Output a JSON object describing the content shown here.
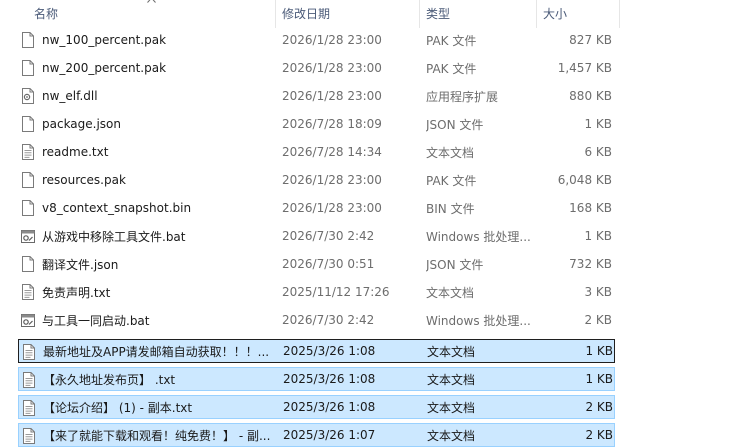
{
  "columns": {
    "name": "名称",
    "modified": "修改日期",
    "type": "类型",
    "size": "大小"
  },
  "files": [
    {
      "name": "nw_100_percent.pak",
      "modified": "2026/1/28 23:00",
      "type": "PAK 文件",
      "size": "827 KB",
      "icon": "file-icon",
      "selected": false
    },
    {
      "name": "nw_200_percent.pak",
      "modified": "2026/1/28 23:00",
      "type": "PAK 文件",
      "size": "1,457 KB",
      "icon": "file-icon",
      "selected": false
    },
    {
      "name": "nw_elf.dll",
      "modified": "2026/1/28 23:00",
      "type": "应用程序扩展",
      "size": "880 KB",
      "icon": "dll-icon",
      "selected": false
    },
    {
      "name": "package.json",
      "modified": "2026/7/28 18:09",
      "type": "JSON 文件",
      "size": "1 KB",
      "icon": "file-icon",
      "selected": false
    },
    {
      "name": "readme.txt",
      "modified": "2026/7/28 14:34",
      "type": "文本文档",
      "size": "6 KB",
      "icon": "text-file-icon",
      "selected": false
    },
    {
      "name": "resources.pak",
      "modified": "2026/1/28 23:00",
      "type": "PAK 文件",
      "size": "6,048 KB",
      "icon": "file-icon",
      "selected": false
    },
    {
      "name": "v8_context_snapshot.bin",
      "modified": "2026/1/28 23:00",
      "type": "BIN 文件",
      "size": "168 KB",
      "icon": "file-icon",
      "selected": false
    },
    {
      "name": "从游戏中移除工具文件.bat",
      "modified": "2026/7/30 2:42",
      "type": "Windows 批处理...",
      "size": "1 KB",
      "icon": "batch-file-icon",
      "selected": false
    },
    {
      "name": "翻译文件.json",
      "modified": "2026/7/30 0:51",
      "type": "JSON 文件",
      "size": "732 KB",
      "icon": "file-icon",
      "selected": false
    },
    {
      "name": "免责声明.txt",
      "modified": "2025/11/12 17:26",
      "type": "文本文档",
      "size": "3 KB",
      "icon": "text-file-icon",
      "selected": false
    },
    {
      "name": "与工具一同启动.bat",
      "modified": "2026/7/30 2:42",
      "type": "Windows 批处理...",
      "size": "2 KB",
      "icon": "batch-file-icon",
      "selected": false
    },
    {
      "name": "最新地址及APP请发邮箱自动获取！！！...",
      "modified": "2025/3/26 1:08",
      "type": "文本文档",
      "size": "1 KB",
      "icon": "text-file-icon",
      "selected": true,
      "focused": true
    },
    {
      "name": "【永久地址发布页】 .txt",
      "modified": "2025/3/26 1:08",
      "type": "文本文档",
      "size": "1 KB",
      "icon": "text-file-icon",
      "selected": true
    },
    {
      "name": "【论坛介绍】 (1) - 副本.txt",
      "modified": "2025/3/26 1:08",
      "type": "文本文档",
      "size": "2 KB",
      "icon": "text-file-icon",
      "selected": true
    },
    {
      "name": "【来了就能下载和观看！纯免费！】 - 副...",
      "modified": "2025/3/26 1:07",
      "type": "文本文档",
      "size": "2 KB",
      "icon": "text-file-icon",
      "selected": true
    }
  ]
}
